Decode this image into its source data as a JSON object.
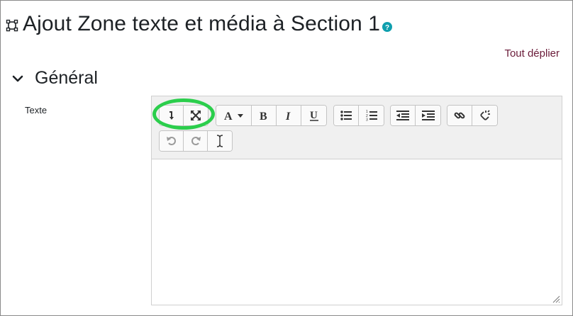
{
  "header": {
    "title": "Ajout Zone texte et média à Section 1",
    "title_icon": "module-icon",
    "help_icon": "help-icon"
  },
  "actions": {
    "expand_all_label": "Tout déplier"
  },
  "section": {
    "title": "Général",
    "expanded": true
  },
  "form": {
    "text_field_label": "Texte"
  },
  "editor": {
    "content": "",
    "toolbar_rows": [
      [
        [
          "toggle-toolbar-icon",
          "fullscreen-icon"
        ],
        [
          "font-color-icon",
          "bold-icon",
          "italic-icon",
          "underline-icon"
        ],
        [
          "bulleted-list-icon",
          "numbered-list-icon"
        ],
        [
          "outdent-icon",
          "indent-icon"
        ],
        [
          "link-icon",
          "unlink-icon"
        ]
      ],
      [
        [
          "undo-icon",
          "redo-icon",
          "text-cursor-icon"
        ]
      ]
    ]
  },
  "annotation": {
    "color": "#2bce4c"
  },
  "colors": {
    "link": "#6a1b39",
    "help": "#0f9fae",
    "toolbar_bg": "#f0f0f0"
  }
}
